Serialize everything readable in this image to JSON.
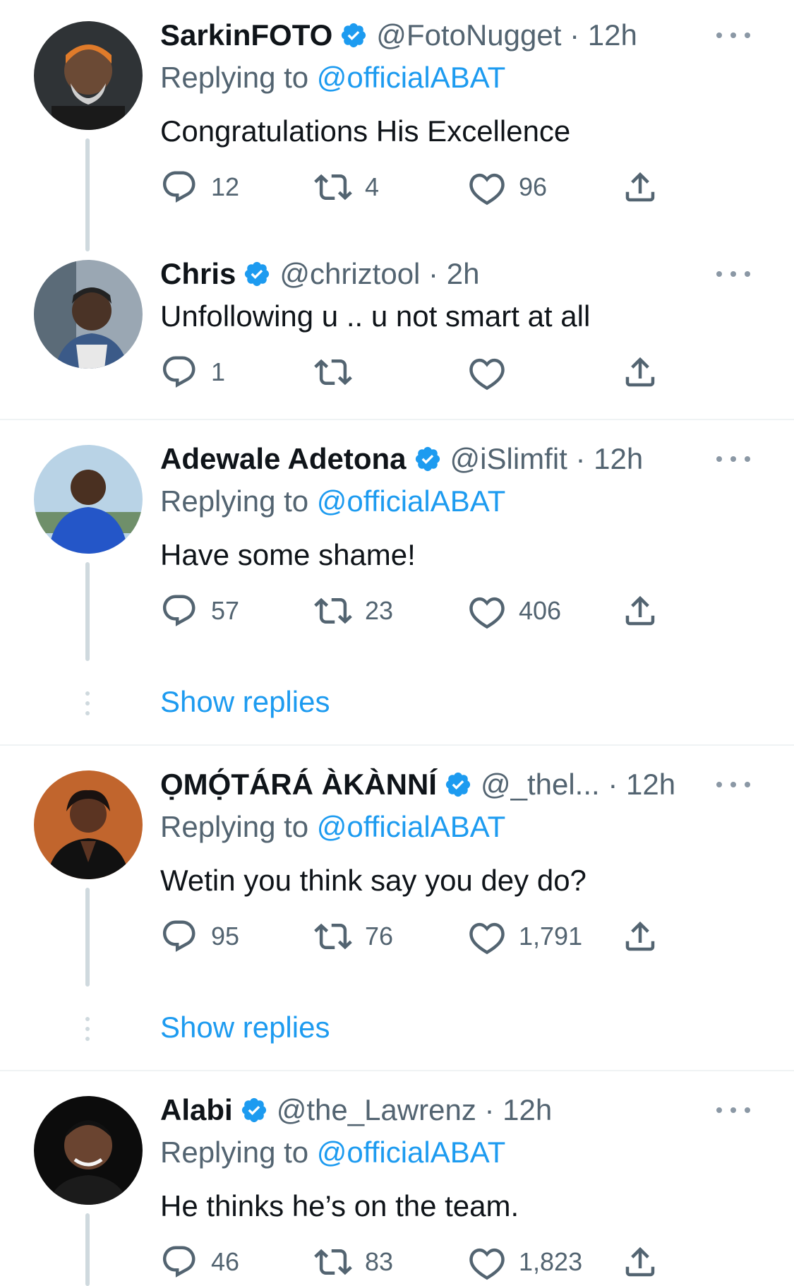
{
  "colors": {
    "accent": "#1d9bf0",
    "muted": "#536471",
    "text": "#0f1419",
    "line": "#cfd9de"
  },
  "tweets": [
    {
      "name": "SarkinFOTO",
      "handle": "@FotoNugget",
      "time": "12h",
      "replying_label": "Replying to",
      "replying_to": "@officialABAT",
      "text": "Congratulations His Excellence",
      "replies": "12",
      "retweets": "4",
      "likes": "96",
      "verified": true,
      "show_replies": ""
    },
    {
      "name": "Chris",
      "handle": "@chriztool",
      "time": "2h",
      "replying_label": "",
      "replying_to": "",
      "text": "Unfollowing u .. u not smart at all",
      "replies": "1",
      "retweets": "",
      "likes": "",
      "verified": true,
      "show_replies": ""
    },
    {
      "name": "Adewale Adetona",
      "handle": "@iSlimfit",
      "time": "12h",
      "replying_label": "Replying to",
      "replying_to": "@officialABAT",
      "text": "Have some shame!",
      "replies": "57",
      "retweets": "23",
      "likes": "406",
      "verified": true,
      "show_replies": "Show replies"
    },
    {
      "name": "ỌMỌ́TÁRÁ ÀKÀNNÍ",
      "handle": "@_thel...",
      "time": "12h",
      "replying_label": "Replying to",
      "replying_to": "@officialABAT",
      "text": "Wetin you think say you dey do?",
      "replies": "95",
      "retweets": "76",
      "likes": "1,791",
      "verified": true,
      "show_replies": "Show replies"
    },
    {
      "name": "Alabi",
      "handle": "@the_Lawrenz",
      "time": "12h",
      "replying_label": "Replying to",
      "replying_to": "@officialABAT",
      "text": "He thinks he’s on the team.",
      "replies": "46",
      "retweets": "83",
      "likes": "1,823",
      "verified": true,
      "show_replies": ""
    }
  ],
  "icons": {
    "reply": "reply-icon",
    "retweet": "retweet-icon",
    "like": "heart-icon",
    "share": "share-icon",
    "more": "more-icon",
    "verified": "verified-badge-icon"
  }
}
